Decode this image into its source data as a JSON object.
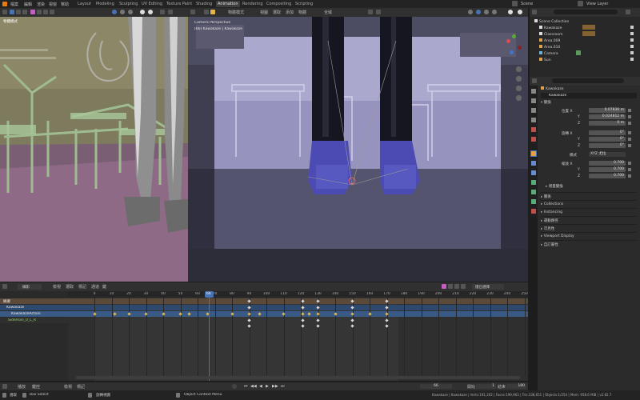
{
  "topbar": {
    "menus": [
      "檔案",
      "編輯",
      "渲染",
      "視窗",
      "幫助"
    ],
    "workspaces": [
      "Layout",
      "Modeling",
      "Sculpting",
      "UV Editing",
      "Texture Paint",
      "Shading",
      "Animation",
      "Rendering",
      "Compositing",
      "Scripting"
    ],
    "active_workspace": "Animation",
    "scene": "Scene",
    "view_layer": "View Layer"
  },
  "viewport_left": {
    "mode": "物體模式"
  },
  "viewport_right": {
    "mode": "物體模式",
    "menus": [
      "視圖",
      "選取",
      "添加",
      "物體"
    ],
    "shading": "全域",
    "overlay_line1": "Camera Perspective",
    "overlay_line2": "(66) Kawakaze | Kawakaze"
  },
  "outliner": {
    "title": "Scene Collection",
    "items": [
      {
        "name": "Kawakaze",
        "color": "#c28a3a"
      },
      {
        "name": "Classroom",
        "color": "#c28a3a"
      },
      {
        "name": "Area.009",
        "color": "#e3a04a"
      },
      {
        "name": "Area.010",
        "color": "#e3a04a"
      },
      {
        "name": "Camera",
        "color": "#6fb1d6"
      },
      {
        "name": "Sun",
        "color": "#e3a04a"
      }
    ]
  },
  "properties": {
    "object_name": "Kawakaze",
    "object_name_field": "Kawakaze",
    "section_transform": "變換",
    "location_label": "位置 X",
    "location": [
      "0.07836 m",
      "0.024812 m",
      "0 m"
    ],
    "rotation_label": "旋轉 X",
    "rotation": [
      "0°",
      "0°",
      "0°"
    ],
    "mode_label": "模式",
    "mode_value": "XYZ 尤拉",
    "scale_label": "縮放 X",
    "scale": [
      "0.700",
      "0.700",
      "0.700"
    ],
    "axis_y": "Y",
    "axis_z": "Z",
    "delta_label": "增量變換",
    "sections": [
      "關係",
      "Collections",
      "Instancing",
      "運動路徑",
      "可見性",
      "Viewport Display",
      "自訂屬性"
    ]
  },
  "timeline": {
    "view_label": "攝影",
    "menus": [
      "檢視",
      "選取",
      "標記",
      "通道",
      "鍵"
    ],
    "sync_label": "僅已選擇",
    "frame_ticks": [
      "-20",
      "0",
      "10",
      "20",
      "30",
      "40",
      "50",
      "60",
      "66",
      "70",
      "80",
      "90",
      "100",
      "110",
      "120",
      "130",
      "140",
      "150",
      "160",
      "170",
      "180",
      "190",
      "200",
      "210",
      "220",
      "230",
      "240",
      "250"
    ],
    "current_frame": "66",
    "summary": "摘要",
    "channel1": "Kawakaze",
    "channel2": "KawakazeAction",
    "channel3": "Sideman_0_L_R",
    "playback_label": "播放",
    "keying_label": "鍵控",
    "view_menu": "檢視",
    "marker_menu": "標記",
    "start_label": "開始",
    "start_value": "1",
    "end_label": "結束",
    "end_value": "180",
    "frame_field": "66"
  },
  "statusbar": {
    "left1": "選取",
    "left2": "Box Select",
    "mid1": "旋轉視圖",
    "mid2": "Object Context Menu",
    "right": "Kawakaze | Kawakaze | Verts:191,202 | Faces:199,963 | Tris:338,651 | Objects:1/254 | Mem: 958.6 MiB | v2.82.7"
  },
  "colors": {
    "accent": "#4772b3",
    "keyframe_white": "#d8d8d8",
    "keyframe_yellow": "#e3b54a",
    "active_channel": "#2d4a6e"
  }
}
